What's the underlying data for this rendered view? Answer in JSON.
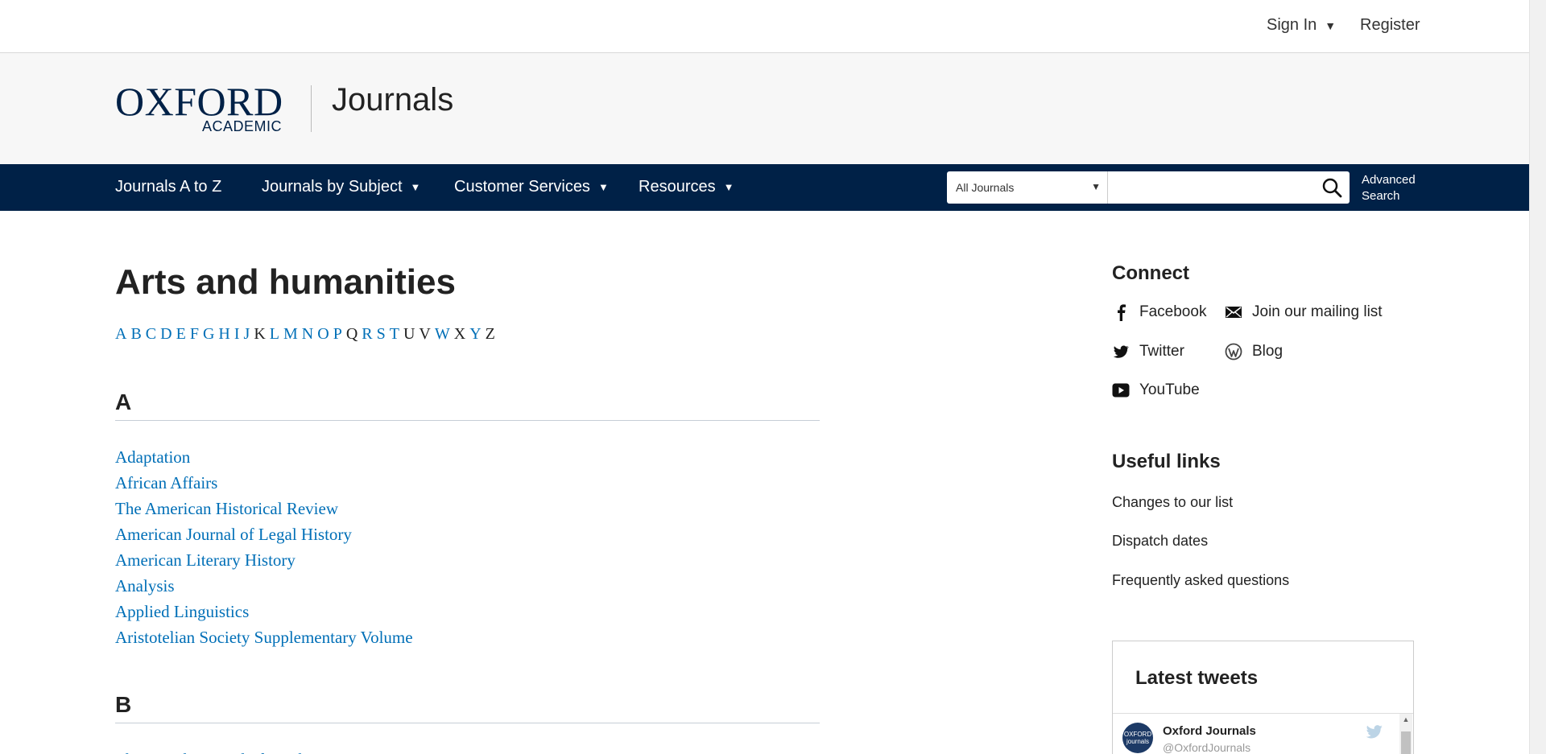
{
  "topbar": {
    "sign_in": "Sign In",
    "register": "Register"
  },
  "brand": {
    "logo_oxford": "OXFORD",
    "logo_academic": "ACADEMIC",
    "section_title": "Journals"
  },
  "nav": {
    "items": [
      {
        "label": "Journals A to Z",
        "has_dropdown": false
      },
      {
        "label": "Journals by Subject",
        "has_dropdown": true
      },
      {
        "label": "Customer Services",
        "has_dropdown": true
      },
      {
        "label": "Resources",
        "has_dropdown": true
      }
    ],
    "search": {
      "scope_selected": "All Journals",
      "query": "",
      "advanced_line1": "Advanced",
      "advanced_line2": "Search"
    }
  },
  "main": {
    "title": "Arts and humanities",
    "letters": [
      {
        "l": "A",
        "active": true
      },
      {
        "l": "B",
        "active": true
      },
      {
        "l": "C",
        "active": true
      },
      {
        "l": "D",
        "active": true
      },
      {
        "l": "E",
        "active": true
      },
      {
        "l": "F",
        "active": true
      },
      {
        "l": "G",
        "active": true
      },
      {
        "l": "H",
        "active": true
      },
      {
        "l": "I",
        "active": true
      },
      {
        "l": "J",
        "active": true
      },
      {
        "l": "K",
        "active": false
      },
      {
        "l": "L",
        "active": true
      },
      {
        "l": "M",
        "active": true
      },
      {
        "l": "N",
        "active": true
      },
      {
        "l": "O",
        "active": true
      },
      {
        "l": "P",
        "active": true
      },
      {
        "l": "Q",
        "active": false
      },
      {
        "l": "R",
        "active": true
      },
      {
        "l": "S",
        "active": true
      },
      {
        "l": "T",
        "active": true
      },
      {
        "l": "U",
        "active": false
      },
      {
        "l": "V",
        "active": false
      },
      {
        "l": "W",
        "active": true
      },
      {
        "l": "X",
        "active": false
      },
      {
        "l": "Y",
        "active": true
      },
      {
        "l": "Z",
        "active": false
      }
    ],
    "sections": [
      {
        "letter": "A",
        "journals": [
          "Adaptation",
          "African Affairs",
          "The American Historical Review",
          "American Journal of Legal History",
          "American Literary History",
          "Analysis",
          "Applied Linguistics",
          "Aristotelian Society Supplementary Volume"
        ]
      },
      {
        "letter": "B",
        "journals": [
          "The British Journal of Aesthetics"
        ]
      }
    ]
  },
  "sidebar": {
    "connect_title": "Connect",
    "connect": [
      {
        "label": "Facebook",
        "icon": "facebook-icon"
      },
      {
        "label": "Join our mailing list",
        "icon": "mail-icon"
      },
      {
        "label": "Twitter",
        "icon": "twitter-icon"
      },
      {
        "label": "Blog",
        "icon": "wordpress-icon"
      },
      {
        "label": "YouTube",
        "icon": "youtube-icon"
      }
    ],
    "useful_title": "Useful links",
    "useful": [
      "Changes to our list",
      "Dispatch dates",
      "Frequently asked questions"
    ],
    "tweets": {
      "title": "Latest tweets",
      "account_name": "Oxford Journals",
      "account_handle": "@OxfordJournals",
      "avatar_text": "OXFORD journals"
    }
  },
  "colors": {
    "navy": "#002147",
    "link": "#006fb7",
    "brand_bg": "#f7f7f7"
  }
}
